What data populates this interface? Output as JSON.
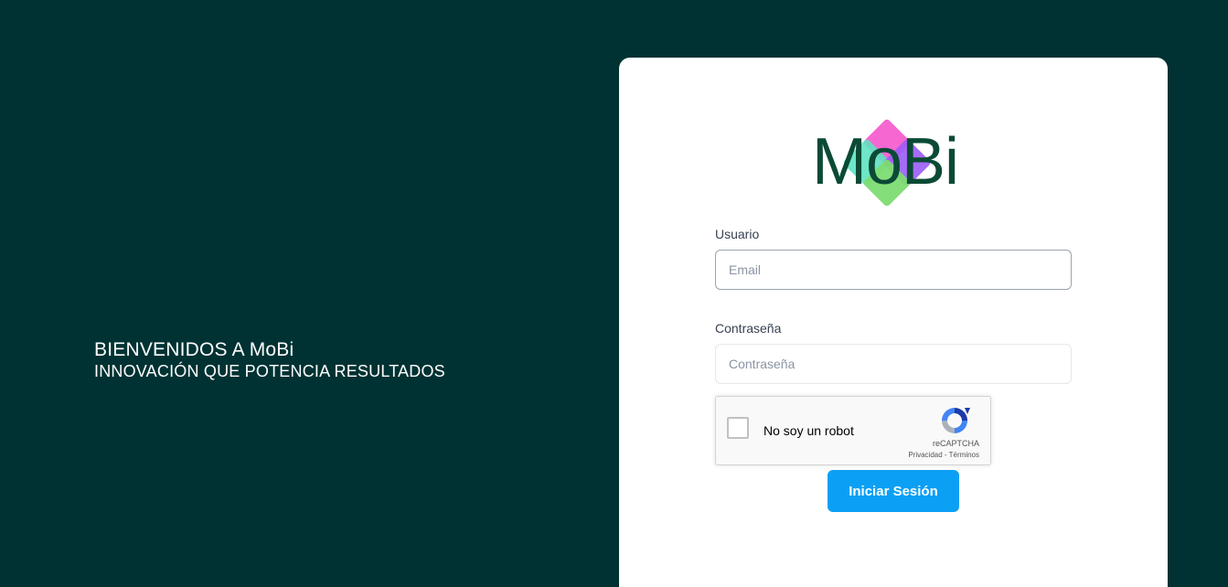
{
  "welcome": {
    "title": "BIENVENIDOS A MoBi",
    "subtitle": "INNOVACIÓN QUE POTENCIA RESULTADOS"
  },
  "logo": {
    "text": "MoBi",
    "colors": [
      "#f75fd0",
      "#5ee3c1",
      "#9b5cf6",
      "#7ddc72"
    ],
    "text_color": "#0b4a35"
  },
  "form": {
    "user_label": "Usuario",
    "email_placeholder": "Email",
    "email_value": "",
    "password_label": "Contraseña",
    "password_placeholder": "Contraseña",
    "password_value": "",
    "submit_label": "Iniciar Sesión"
  },
  "recaptcha": {
    "label": "No soy un robot",
    "brand": "reCAPTCHA",
    "privacy": "Privacidad",
    "separator": " - ",
    "terms": "Términos",
    "checked": false
  },
  "colors": {
    "background": "#003233",
    "card": "#ffffff",
    "button": "#0ba0f4",
    "button_text": "#ffffff"
  }
}
